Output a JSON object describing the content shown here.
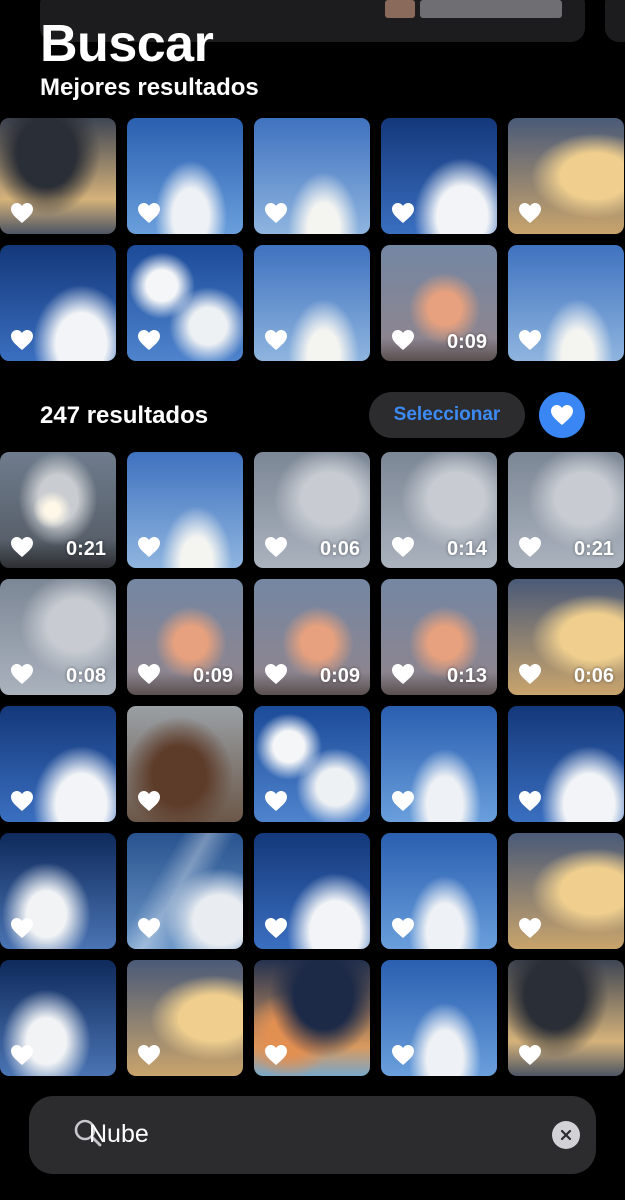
{
  "header": {
    "title": "Buscar",
    "subtitle": "Mejores resultados"
  },
  "best_results": [
    {
      "sky": "sky-storm",
      "duration": ""
    },
    {
      "sky": "sky-blue",
      "duration": ""
    },
    {
      "sky": "sky-pale",
      "duration": ""
    },
    {
      "sky": "sky-deep",
      "duration": ""
    },
    {
      "sky": "sky-gold",
      "duration": ""
    },
    {
      "sky": "sky-deep",
      "duration": ""
    },
    {
      "sky": "sky-puffy",
      "duration": ""
    },
    {
      "sky": "sky-pale",
      "duration": ""
    },
    {
      "sky": "sky-pink",
      "duration": "0:09"
    },
    {
      "sky": "sky-pale",
      "duration": ""
    }
  ],
  "results_header": {
    "count_label": "247 resultados",
    "select_label": "Seleccionar"
  },
  "results": [
    {
      "sky": "sky-grey-sun",
      "duration": "0:21"
    },
    {
      "sky": "sky-pale",
      "duration": ""
    },
    {
      "sky": "sky-grey",
      "duration": "0:06"
    },
    {
      "sky": "sky-grey",
      "duration": "0:14"
    },
    {
      "sky": "sky-grey",
      "duration": "0:21"
    },
    {
      "sky": "sky-grey",
      "duration": "0:08"
    },
    {
      "sky": "sky-pink",
      "duration": "0:09"
    },
    {
      "sky": "sky-pink",
      "duration": "0:09"
    },
    {
      "sky": "sky-pink",
      "duration": "0:13"
    },
    {
      "sky": "sky-gold",
      "duration": "0:06"
    },
    {
      "sky": "sky-deep",
      "duration": ""
    },
    {
      "sky": "sky-dusk",
      "duration": ""
    },
    {
      "sky": "sky-puffy",
      "duration": ""
    },
    {
      "sky": "sky-blue",
      "duration": ""
    },
    {
      "sky": "sky-deep",
      "duration": ""
    },
    {
      "sky": "sky-dark-edge",
      "duration": ""
    },
    {
      "sky": "sky-streak",
      "duration": ""
    },
    {
      "sky": "sky-deep",
      "duration": ""
    },
    {
      "sky": "sky-blue",
      "duration": ""
    },
    {
      "sky": "sky-gold",
      "duration": ""
    },
    {
      "sky": "sky-dark-edge",
      "duration": ""
    },
    {
      "sky": "sky-gold",
      "duration": ""
    },
    {
      "sky": "sky-sunset",
      "duration": ""
    },
    {
      "sky": "sky-blue",
      "duration": ""
    },
    {
      "sky": "sky-storm",
      "duration": ""
    }
  ],
  "search": {
    "value": "Nube",
    "icon": "search-icon",
    "clear_icon": "clear-icon"
  },
  "colors": {
    "background": "#000000",
    "accent": "#3a86f4",
    "button_bg": "#2c2c2e",
    "link": "#3c8bf5"
  }
}
